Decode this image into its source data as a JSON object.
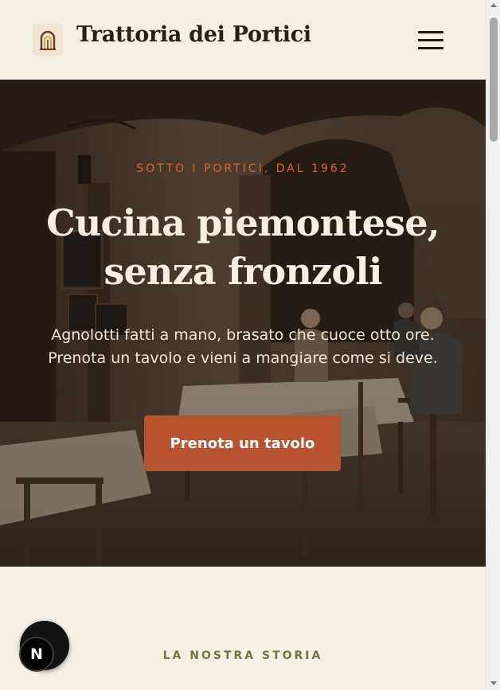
{
  "header": {
    "brand": "Trattoria dei Portici",
    "logo_icon": "arch-icon",
    "menu_icon": "hamburger-menu-icon"
  },
  "hero": {
    "eyebrow": "SOTTO I PORTICI, DAL 1962",
    "headline_line1": "Cucina piemontese,",
    "headline_line2": "senza fronzoli",
    "subline_line1": "Agnolotti fatti a mano, brasato che cuoce otto ore.",
    "subline_line2": "Prenota un tavolo e vieni a mangiare come si deve.",
    "cta_label": "Prenota un tavolo"
  },
  "story": {
    "label": "LA NOSTRA STORIA"
  },
  "dev_badge": {
    "letter": "N"
  },
  "colors": {
    "accent": "#b8532f",
    "eyebrow": "#d4653a",
    "olive": "#6b7a3e",
    "background": "#f6efe4",
    "text_dark": "#2a1f17"
  }
}
